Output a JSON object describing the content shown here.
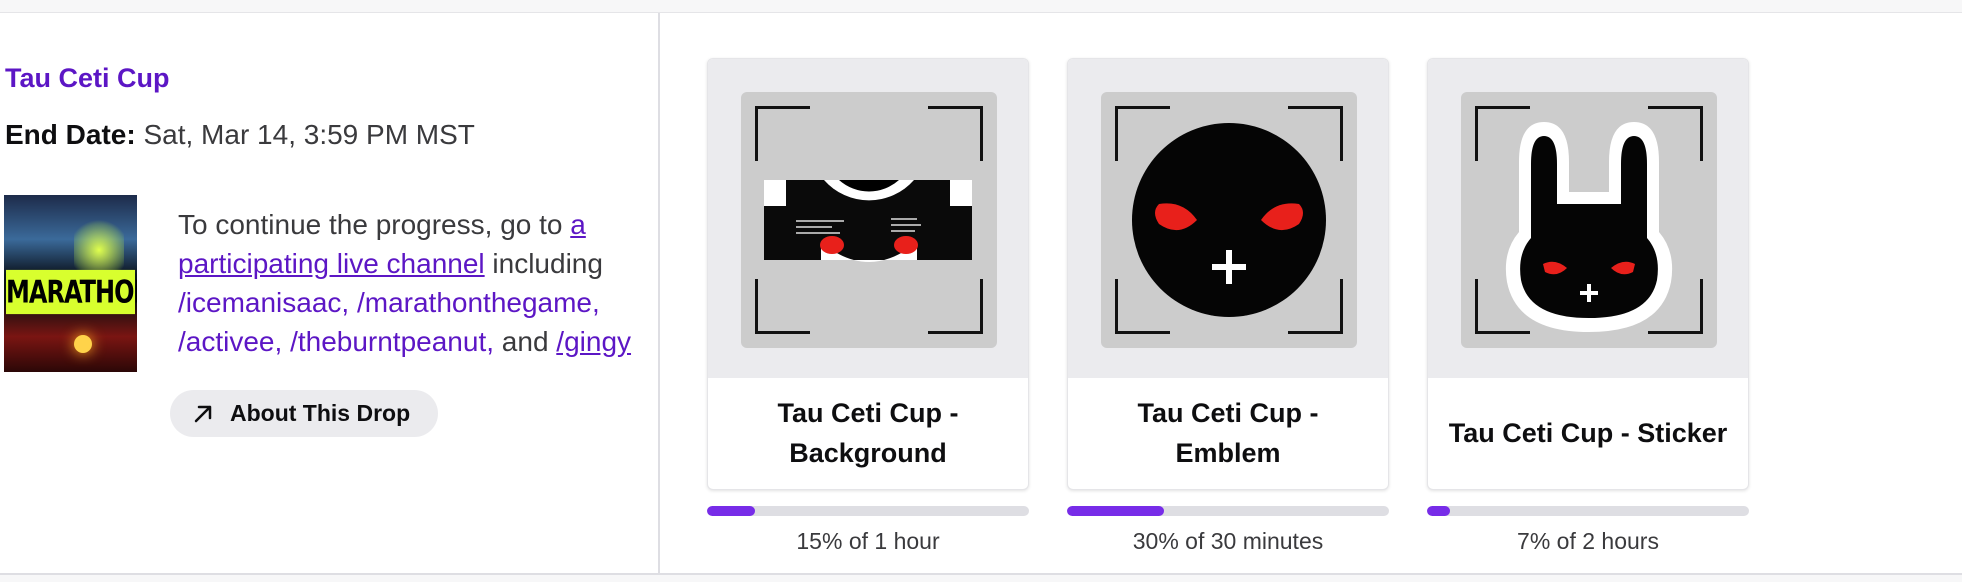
{
  "campaign": {
    "title": "Tau Ceti Cup",
    "end_date_label": "End Date:",
    "end_date_value": " Sat, Mar 14, 3:59 PM MST",
    "game_name": "MARATHON",
    "progress_intro": "To continue the progress, go to ",
    "participating_link": "a participating live channel",
    "including": " including ",
    "channels": [
      "/icemanisaac,",
      "/marathonthegame,",
      "/activee,",
      "/theburntpeanut,"
    ],
    "and": " and ",
    "last_channel": "/gingy",
    "about_button": "About This Drop",
    "about_icon": "external-arrow-icon"
  },
  "rewards": [
    {
      "name": "Tau Ceti Cup - Background",
      "progress_percent": 15,
      "progress_label": "15% of 1 hour"
    },
    {
      "name": "Tau Ceti Cup - Emblem",
      "progress_percent": 30,
      "progress_label": "30% of 30 minutes"
    },
    {
      "name": "Tau Ceti Cup - Sticker",
      "progress_percent": 7,
      "progress_label": "7% of 2 hours"
    }
  ],
  "colors": {
    "accent": "#772ce8",
    "link": "#5c16c5",
    "track": "#dedee3",
    "eye_red": "#e8201b"
  }
}
